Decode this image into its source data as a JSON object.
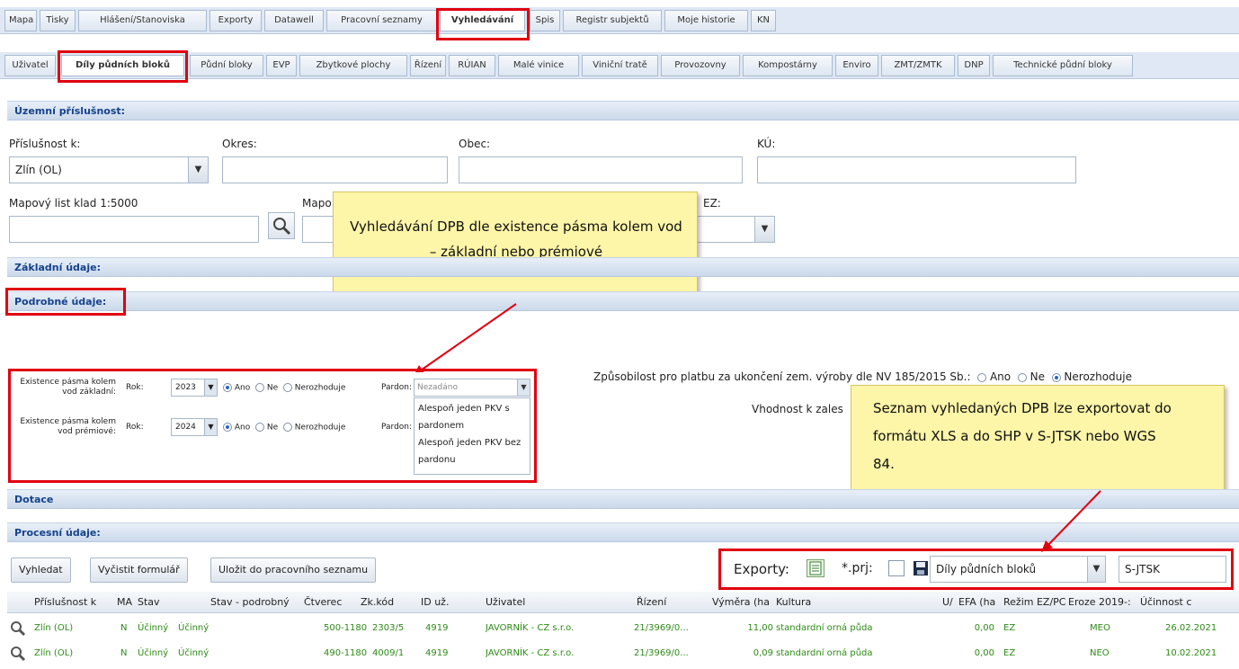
{
  "main_tabs": [
    "Mapa",
    "Tisky",
    "Hlášení/Stanoviska",
    "Exporty",
    "Datawell",
    "Pracovní seznamy",
    "Vyhledávání",
    "Spis",
    "Registr subjektů",
    "Moje historie",
    "KN"
  ],
  "sub_tabs": [
    "Uživatel",
    "Díly půdních bloků",
    "Půdní bloky",
    "EVP",
    "Zbytkové plochy",
    "Řízení",
    "RÚIAN",
    "Malé vinice",
    "Viniční tratě",
    "Provozovny",
    "Kompostárny",
    "Enviro",
    "ZMT/ZMTK",
    "DNP",
    "Technické půdní bloky"
  ],
  "sections": {
    "territorial": "Územní příslušnost:",
    "basic": "Základní údaje:",
    "detailed": "Podrobné údaje:",
    "subsidy": "Dotace",
    "process": "Procesní údaje:"
  },
  "form": {
    "prislusnost_label": "Příslušnost k:",
    "prislusnost_value": "Zlín (OL)",
    "okres_label": "Okres:",
    "obec_label": "Obec:",
    "ku_label": "KÚ:",
    "mapovy_list_label": "Mapový list klad 1:5000",
    "mapo_label": "Mapo",
    "ez_label": "EZ:"
  },
  "callouts": {
    "search_note": "Vyhledávání DPB dle existence pásma kolem vod – základní nebo prémiové",
    "export_note": "Seznam vyhledaných DPB lze exportovat do formátu XLS a do SHP v S-JTSK nebo WGS 84."
  },
  "buffer": {
    "row1_label": "Existence pásma kolem vod základní:",
    "row2_label": "Existence pásma kolem vod prémiové:",
    "rok_label": "Rok:",
    "row1_year": "2023",
    "row2_year": "2024",
    "ano": "Ano",
    "ne": "Ne",
    "nerozhoduje": "Nerozhoduje",
    "pardon_label": "Pardon:",
    "pardon_value": "Nezadáno",
    "pardon_options": [
      "Alespoň jeden PKV s pardonem",
      "Alespoň jeden PKV bez pardonu"
    ]
  },
  "eligibility": {
    "label": "Způsobilost pro platbu za ukončení zem. výroby dle NV 185/2015 Sb.:",
    "ano": "Ano",
    "ne": "Ne",
    "nerozhoduje": "Nerozhoduje",
    "suitability": "Vhodnost k zales"
  },
  "toolbar": {
    "search": "Vyhledat",
    "clear": "Vyčistit formulář",
    "save": "Uložit do pracovního seznamu",
    "exports_label": "Exporty:",
    "prj_label": "*.prj:",
    "export_layer": "Díly půdních bloků",
    "crs": "S-JTSK"
  },
  "grid": {
    "columns": [
      "Příslušnost k",
      "MA",
      "Stav",
      "Stav - podrobný",
      "Čtverec",
      "Zk.kód",
      "ID už.",
      "Uživatel",
      "Řízení",
      "Výměra (ha",
      "Kultura",
      "U/",
      "EFA (ha",
      "Režim EZ/PC",
      "Eroze 2019-:",
      "Účinnost c"
    ],
    "rows": [
      [
        "Zlín (OL)",
        "N",
        "Účinný",
        "Účinný",
        "500-1180",
        "2303/5",
        "4919",
        "JAVORNÍK - CZ s.r.o.",
        "21/3969/0...",
        "11,00",
        "standardní orná půda",
        "",
        "0,00",
        "EZ",
        "MEO",
        "26.02.2021"
      ],
      [
        "Zlín (OL)",
        "N",
        "Účinný",
        "Účinný",
        "490-1180",
        "4009/1",
        "4919",
        "JAVORNÍK - CZ s.r.o.",
        "21/3969/0...",
        "0,09",
        "standardní orná půda",
        "",
        "0,00",
        "EZ",
        "NEO",
        "10.02.2021"
      ]
    ]
  },
  "colors": {
    "highlight": "#e00010",
    "callout_bg": "#fdf5a8",
    "row_text": "#2d8a16",
    "section_text": "#15428b"
  }
}
